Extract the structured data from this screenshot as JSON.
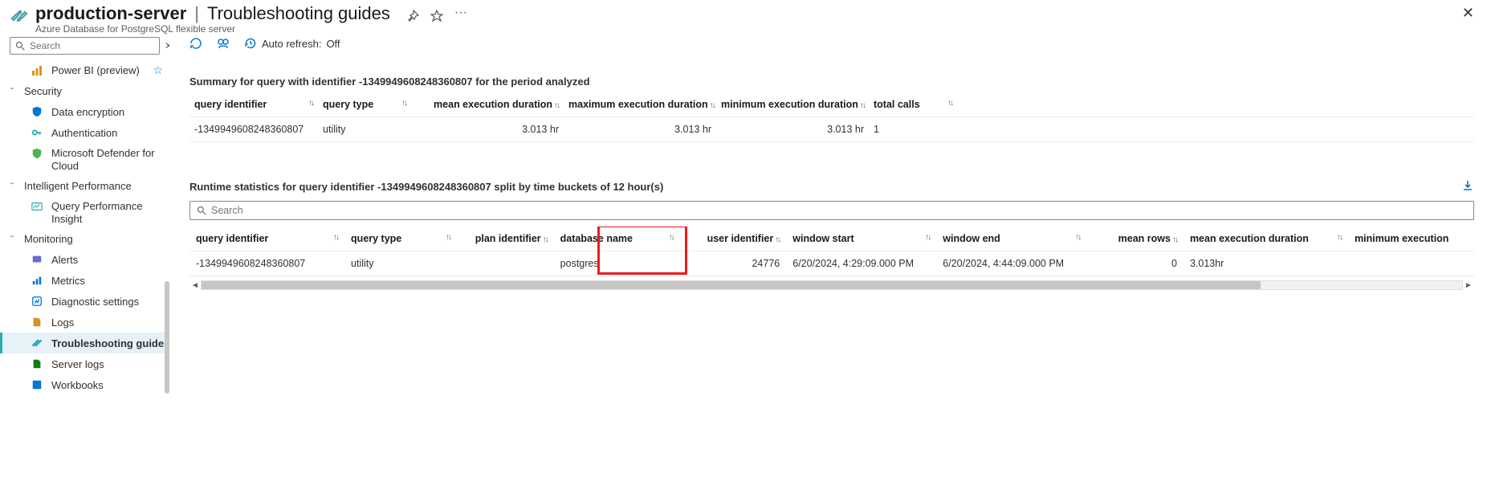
{
  "header": {
    "server_name": "production-server",
    "page_name": "Troubleshooting guides",
    "subtitle": "Azure Database for PostgreSQL flexible server",
    "pin_title": "Pin",
    "fav_title": "Favorite",
    "more_title": "More",
    "close_title": "Close"
  },
  "sidebar": {
    "search_placeholder": "Search",
    "items": {
      "powerbi": "Power BI (preview)",
      "security_section": "Security",
      "data_encryption": "Data encryption",
      "authentication": "Authentication",
      "defender": "Microsoft Defender for Cloud",
      "intelligent_section": "Intelligent Performance",
      "qpi": "Query Performance Insight",
      "monitoring_section": "Monitoring",
      "alerts": "Alerts",
      "metrics": "Metrics",
      "diag": "Diagnostic settings",
      "logs": "Logs",
      "tsg": "Troubleshooting guides",
      "server_logs": "Server logs",
      "workbooks": "Workbooks"
    }
  },
  "toolbar": {
    "refresh_title": "Refresh",
    "feedback_title": "Feedback",
    "auto_refresh_label": "Auto refresh:",
    "auto_refresh_value": "Off"
  },
  "summary": {
    "title": "Summary for query with identifier -1349949608248360807 for the period analyzed",
    "columns": {
      "qid": "query identifier",
      "qtype": "query type",
      "mean": "mean execution duration",
      "max": "maximum execution duration",
      "min": "minimum execution duration",
      "calls": "total calls"
    },
    "row": {
      "qid": "-1349949608248360807",
      "qtype": "utility",
      "mean": "3.013 hr",
      "max": "3.013 hr",
      "min": "3.013 hr",
      "calls": "1"
    }
  },
  "runtime": {
    "title": "Runtime statistics for query identifier -1349949608248360807 split by time buckets of 12 hour(s)",
    "search_placeholder": "Search",
    "download_title": "Download",
    "columns": {
      "qid": "query identifier",
      "qtype": "query type",
      "plan": "plan identifier",
      "db": "database name",
      "user": "user identifier",
      "wstart": "window start",
      "wend": "window end",
      "mrows": "mean rows",
      "mexec": "mean execution duration",
      "minexec": "minimum execution"
    },
    "row": {
      "qid": "-1349949608248360807",
      "qtype": "utility",
      "plan": "",
      "db": "postgres",
      "user": "24776",
      "wstart": "6/20/2024, 4:29:09.000 PM",
      "wend": "6/20/2024, 4:44:09.000 PM",
      "mrows": "0",
      "mexec": "3.013hr",
      "minexec": ""
    }
  }
}
